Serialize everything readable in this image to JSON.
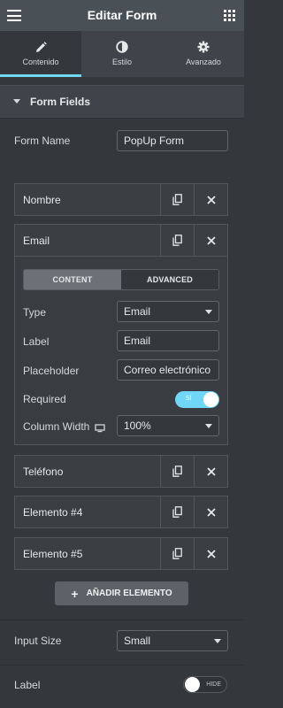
{
  "header": {
    "title": "Editar Form",
    "menu_icon": "hamburger-icon",
    "grid_icon": "grid-icon"
  },
  "tabs": [
    {
      "label": "Contenido",
      "icon": "pencil-icon",
      "active": true
    },
    {
      "label": "Estilo",
      "icon": "half-circle-icon",
      "active": false
    },
    {
      "label": "Avanzado",
      "icon": "gear-icon",
      "active": false
    }
  ],
  "section": {
    "title": "Form Fields"
  },
  "form_name": {
    "label": "Form Name",
    "value": "PopUp Form"
  },
  "fields": [
    {
      "label": "Nombre"
    },
    {
      "label": "Email"
    },
    {
      "label": "Teléfono"
    },
    {
      "label": "Elemento #4"
    },
    {
      "label": "Elemento #5"
    }
  ],
  "field_editor": {
    "content_tab": "CONTENT",
    "advanced_tab": "ADVANCED",
    "type_label": "Type",
    "type_value": "Email",
    "label_label": "Label",
    "label_value": "Email",
    "placeholder_label": "Placeholder",
    "placeholder_value": "Correo electrónico",
    "required_label": "Required",
    "required_toggle_text": "SÍ",
    "required_on": true,
    "column_width_label": "Column Width",
    "column_width_value": "100%"
  },
  "add_button": {
    "label": "AÑADIR ELEMENTO"
  },
  "input_size": {
    "label": "Input Size",
    "value": "Small"
  },
  "label_toggle": {
    "label": "Label",
    "toggle_text": "HIDE",
    "on": false
  },
  "colors": {
    "accent": "#71d7f7",
    "panel": "#34383c",
    "header": "#495157"
  }
}
